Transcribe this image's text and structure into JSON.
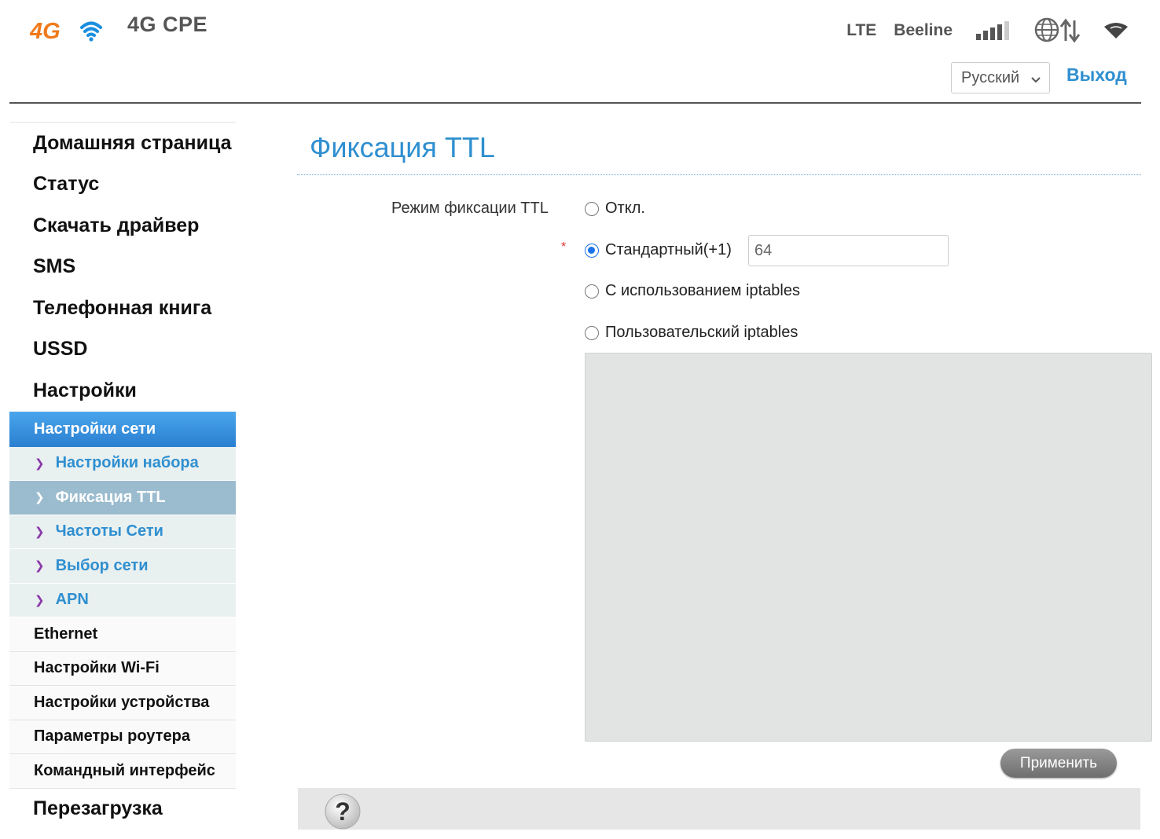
{
  "header": {
    "brand": "4G CPE",
    "network_type": "LTE",
    "operator": "Beeline",
    "signal_bars": 4,
    "language": "Русский",
    "logout": "Выход",
    "colors": {
      "accent": "#2f8fd0",
      "logo_orange": "#f07a1a",
      "logo_blue": "#1a8fe0"
    }
  },
  "sidebar": {
    "main_items": [
      {
        "label": "Домашняя страница"
      },
      {
        "label": "Статус"
      },
      {
        "label": "Скачать драйвер"
      },
      {
        "label": "SMS"
      },
      {
        "label": "Телефонная книга"
      },
      {
        "label": "USSD"
      },
      {
        "label": "Настройки"
      }
    ],
    "group_head": "Настройки сети",
    "sub_items": [
      {
        "label": "Настройки набора",
        "active": false
      },
      {
        "label": "Фиксация TTL",
        "active": true
      },
      {
        "label": "Частоты Сети",
        "active": false
      },
      {
        "label": "Выбор сети",
        "active": false
      },
      {
        "label": "APN",
        "active": false
      }
    ],
    "plain_items": [
      {
        "label": "Ethernet"
      },
      {
        "label": "Настройки Wi-Fi"
      },
      {
        "label": "Настройки устройства"
      },
      {
        "label": "Параметры роутера"
      },
      {
        "label": "Командный интерфейс"
      }
    ],
    "last_item": "Перезагрузка"
  },
  "main": {
    "title": "Фиксация TTL",
    "field_label": "Режим фиксации TTL",
    "required_mark": "*",
    "options": [
      {
        "label": "Откл.",
        "checked": false
      },
      {
        "label": "Стандартный(+1)",
        "checked": true
      },
      {
        "label": "С использованием iptables",
        "checked": false
      },
      {
        "label": "Пользовательский iptables",
        "checked": false
      }
    ],
    "ttl_value": "64",
    "iptables_text": "",
    "apply": "Применить",
    "help": "?"
  }
}
